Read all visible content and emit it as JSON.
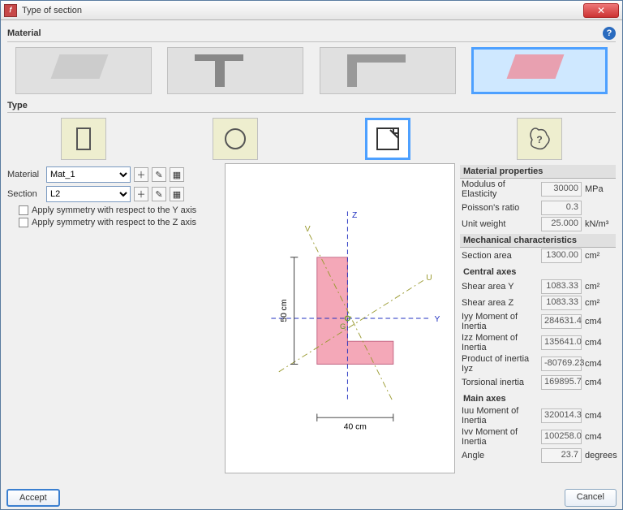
{
  "window": {
    "title": "Type of section"
  },
  "groups": {
    "material": "Material",
    "type": "Type"
  },
  "materials": [
    {
      "id": "concrete",
      "selected": false
    },
    {
      "id": "steel-rolled",
      "selected": false
    },
    {
      "id": "steel-coldformed",
      "selected": false
    },
    {
      "id": "generic-pink",
      "selected": true
    }
  ],
  "types": {
    "rect": "rectangle",
    "circle": "circle",
    "custom": "custom-shape",
    "unknown": "import-shape",
    "selected": "custom"
  },
  "form": {
    "material_label": "Material",
    "material_value": "Mat_1",
    "section_label": "Section",
    "section_value": "L2",
    "symmetry_y": "Apply symmetry with respect to the Y axis",
    "symmetry_z": "Apply symmetry with respect to the Z axis"
  },
  "preview": {
    "width_label": "40 cm",
    "height_label": "50 cm",
    "axes": {
      "z": "Z",
      "y": "Y",
      "u": "U",
      "v": "V",
      "g": "G"
    }
  },
  "props": {
    "hdr_material": "Material properties",
    "modulus": {
      "label": "Modulus of Elasticity",
      "value": "30000",
      "unit": "MPa"
    },
    "poisson": {
      "label": "Poisson's ratio",
      "value": "0.3",
      "unit": ""
    },
    "unitweight": {
      "label": "Unit weight",
      "value": "25.000",
      "unit": "kN/m³"
    },
    "hdr_mech": "Mechanical characteristics",
    "area": {
      "label": "Section area",
      "value": "1300.00",
      "unit": "cm²"
    },
    "hdr_central": "Central axes",
    "sheary": {
      "label": "Shear area Y",
      "value": "1083.33",
      "unit": "cm²"
    },
    "shearz": {
      "label": "Shear area Z",
      "value": "1083.33",
      "unit": "cm²"
    },
    "iyy": {
      "label": "Iyy Moment of Inertia",
      "value": "284631.4",
      "unit": "cm4"
    },
    "izz": {
      "label": "Izz Moment of Inertia",
      "value": "135641.0",
      "unit": "cm4"
    },
    "iyz": {
      "label": "Product of inertia Iyz",
      "value": "-80769.23",
      "unit": "cm4"
    },
    "tors": {
      "label": "Torsional inertia",
      "value": "169895.7",
      "unit": "cm4"
    },
    "hdr_main": "Main axes",
    "iuu": {
      "label": "Iuu Moment of Inertia",
      "value": "320014.3",
      "unit": "cm4"
    },
    "ivv": {
      "label": "Ivv Moment of Inertia",
      "value": "100258.0",
      "unit": "cm4"
    },
    "angle": {
      "label": "Angle",
      "value": "23.7",
      "unit": "degrees"
    }
  },
  "buttons": {
    "accept": "Accept",
    "cancel": "Cancel"
  }
}
